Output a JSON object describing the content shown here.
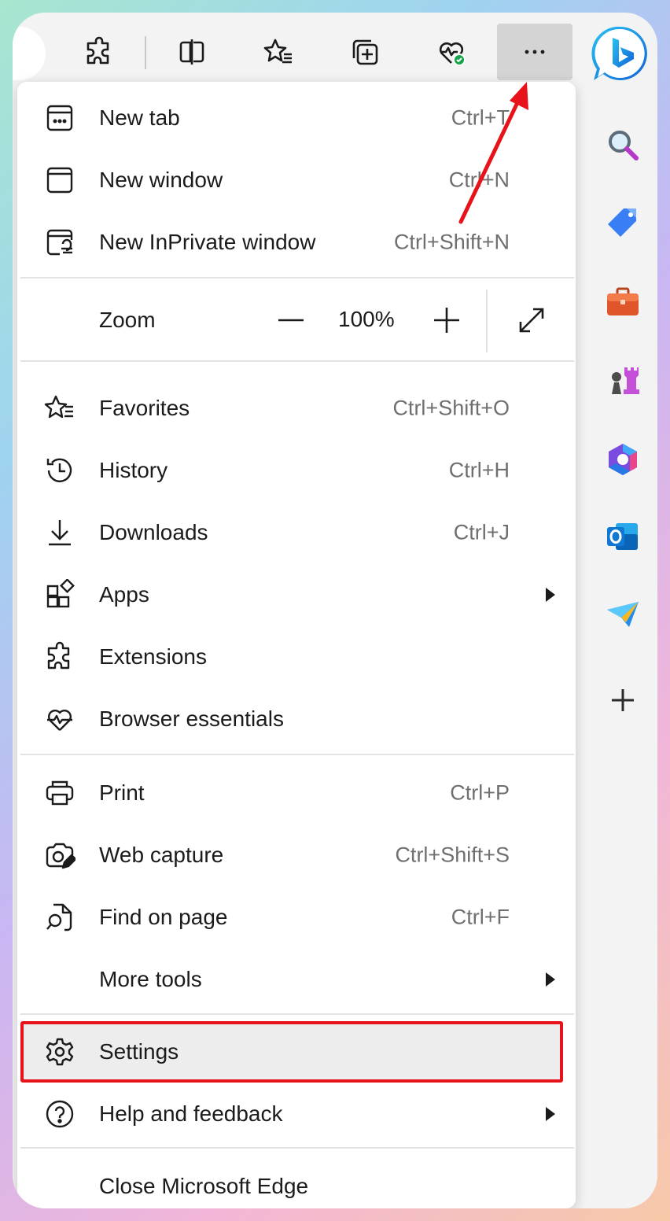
{
  "colors": {
    "accent_red": "#e8131a",
    "menu_bg": "#ffffff",
    "hover_bg": "#ededed",
    "shortcut_text": "#6f6f6f"
  },
  "toolbar": {
    "buttons": [
      "extensions-icon",
      "split-screen-icon",
      "favorites-icon",
      "collections-icon",
      "browser-essentials-icon",
      "more-menu-icon"
    ]
  },
  "sidebar": {
    "icons": [
      "search-icon",
      "shopping-tag-icon",
      "tools-icon",
      "games-icon",
      "microsoft365-icon",
      "outlook-icon",
      "drop-icon",
      "add-icon"
    ]
  },
  "menu": {
    "new_tab": {
      "label": "New tab",
      "shortcut": "Ctrl+T"
    },
    "new_window": {
      "label": "New window",
      "shortcut": "Ctrl+N"
    },
    "new_inprivate": {
      "label": "New InPrivate window",
      "shortcut": "Ctrl+Shift+N"
    },
    "zoom": {
      "label": "Zoom",
      "value": "100%"
    },
    "favorites": {
      "label": "Favorites",
      "shortcut": "Ctrl+Shift+O"
    },
    "history": {
      "label": "History",
      "shortcut": "Ctrl+H"
    },
    "downloads": {
      "label": "Downloads",
      "shortcut": "Ctrl+J"
    },
    "apps": {
      "label": "Apps"
    },
    "extensions": {
      "label": "Extensions"
    },
    "browser_essentials": {
      "label": "Browser essentials"
    },
    "print": {
      "label": "Print",
      "shortcut": "Ctrl+P"
    },
    "web_capture": {
      "label": "Web capture",
      "shortcut": "Ctrl+Shift+S"
    },
    "find_on_page": {
      "label": "Find on page",
      "shortcut": "Ctrl+F"
    },
    "more_tools": {
      "label": "More tools"
    },
    "settings": {
      "label": "Settings"
    },
    "help": {
      "label": "Help and feedback"
    },
    "close": {
      "label": "Close Microsoft Edge"
    }
  }
}
